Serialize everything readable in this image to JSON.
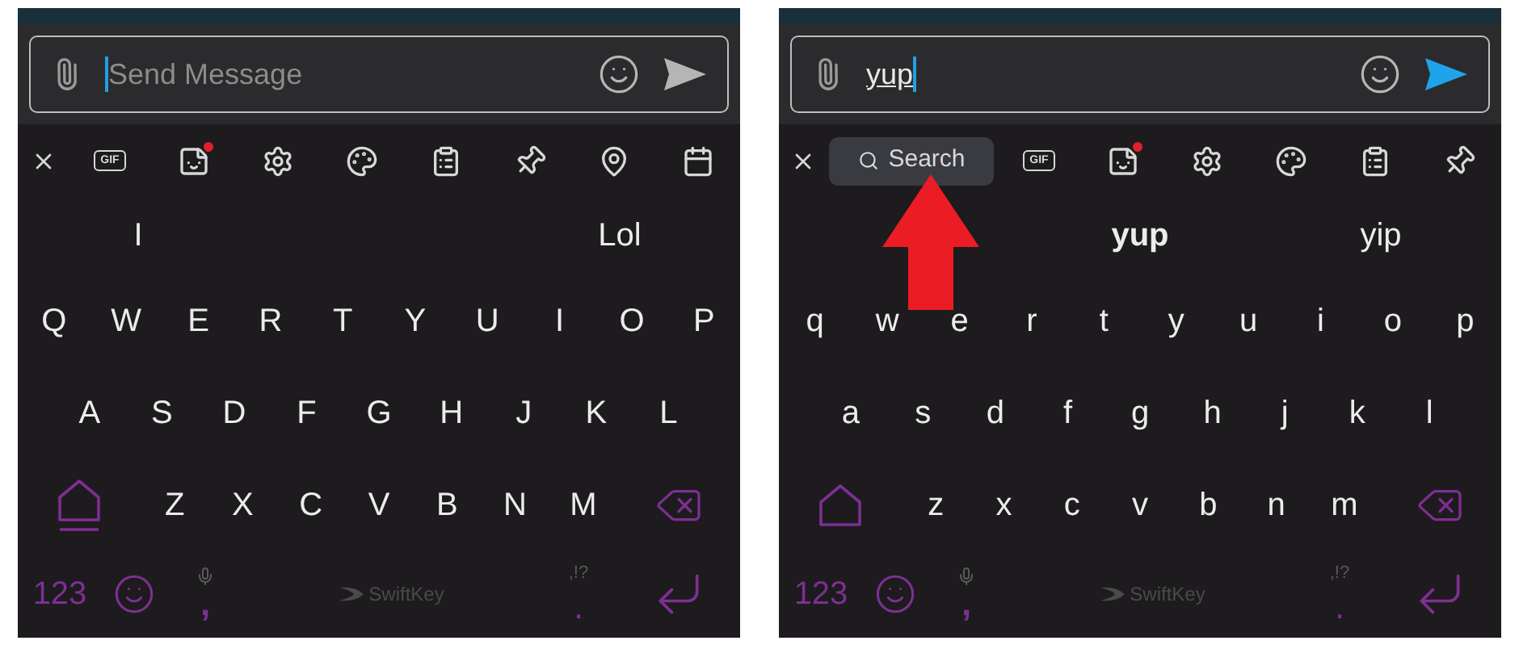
{
  "panels": [
    {
      "message_field": {
        "placeholder": "Send Message"
      },
      "send_enabled": false,
      "toolbar": [
        {
          "kind": "close"
        },
        {
          "kind": "gif",
          "label": "GIF"
        },
        {
          "kind": "sticker",
          "badge": true
        },
        {
          "kind": "settings"
        },
        {
          "kind": "palette"
        },
        {
          "kind": "clipboard"
        },
        {
          "kind": "pin"
        },
        {
          "kind": "location"
        },
        {
          "kind": "calendar"
        }
      ],
      "suggestions": {
        "left": {
          "text": "I",
          "selected": false
        },
        "right": {
          "text": "Lol",
          "selected": false
        }
      },
      "shift_locked": true,
      "key_rows": [
        [
          "Q",
          "W",
          "E",
          "R",
          "T",
          "Y",
          "U",
          "I",
          "O",
          "P"
        ],
        [
          "A",
          "S",
          "D",
          "F",
          "G",
          "H",
          "J",
          "K",
          "L"
        ],
        [
          "Z",
          "X",
          "C",
          "V",
          "B",
          "N",
          "M"
        ]
      ],
      "bottom_row": {
        "numbers_key": "123",
        "comma_key": ",",
        "space_label": "SwiftKey",
        "punctuation_hint": ",!?",
        "period_key": "."
      }
    },
    {
      "message_field": {
        "value": "yup"
      },
      "send_enabled": true,
      "toolbar": [
        {
          "kind": "close"
        },
        {
          "kind": "search",
          "label": "Search"
        },
        {
          "kind": "gif",
          "label": "GIF"
        },
        {
          "kind": "sticker",
          "badge": true
        },
        {
          "kind": "settings"
        },
        {
          "kind": "palette"
        },
        {
          "kind": "clipboard"
        },
        {
          "kind": "pin"
        }
      ],
      "suggestions": {
        "center": {
          "text": "yup",
          "selected": true
        },
        "right": {
          "text": "yip",
          "selected": false
        }
      },
      "shift_locked": false,
      "key_rows": [
        [
          "q",
          "w",
          "e",
          "r",
          "t",
          "y",
          "u",
          "i",
          "o",
          "p"
        ],
        [
          "a",
          "s",
          "d",
          "f",
          "g",
          "h",
          "j",
          "k",
          "l"
        ],
        [
          "z",
          "x",
          "c",
          "v",
          "b",
          "n",
          "m"
        ]
      ],
      "bottom_row": {
        "numbers_key": "123",
        "comma_key": ",",
        "space_label": "SwiftKey",
        "punctuation_hint": ",!?",
        "period_key": "."
      }
    }
  ]
}
